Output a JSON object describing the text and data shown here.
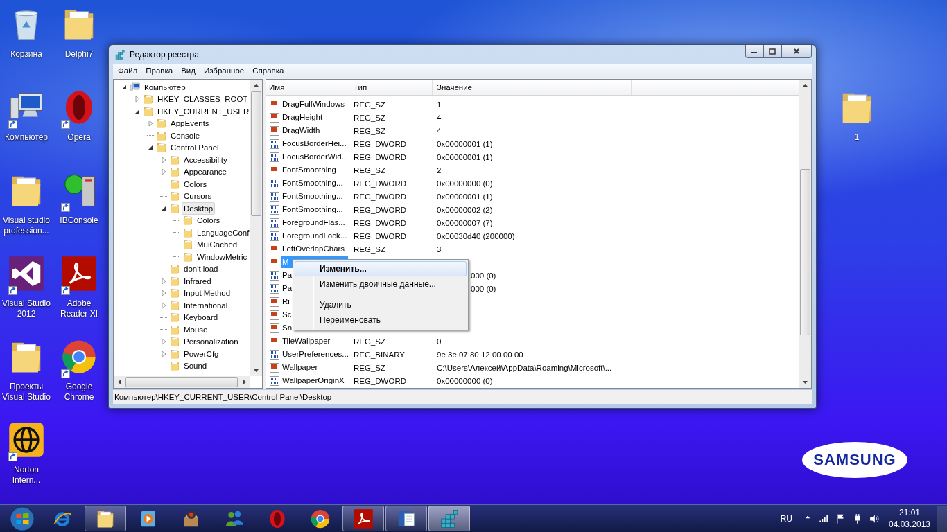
{
  "desktop_icons": [
    {
      "label": "Корзина",
      "kind": "recycle",
      "shortcut": false
    },
    {
      "label": "Delphi7",
      "kind": "folder",
      "shortcut": false
    },
    {
      "label": "Компьютер",
      "kind": "computer",
      "shortcut": true
    },
    {
      "label": "Opera",
      "kind": "opera",
      "shortcut": true
    },
    {
      "label": "Visual studio\nprofession...",
      "kind": "folder",
      "shortcut": false
    },
    {
      "label": "IBConsole",
      "kind": "server",
      "shortcut": true
    },
    {
      "label": "Visual Studio\n2012",
      "kind": "vs",
      "shortcut": true
    },
    {
      "label": "Adobe\nReader XI",
      "kind": "pdf",
      "shortcut": true
    },
    {
      "label": "Проекты\nVisual Studio",
      "kind": "folder",
      "shortcut": false
    },
    {
      "label": "Google\nChrome",
      "kind": "chrome",
      "shortcut": true
    },
    {
      "label": "Norton\nIntern...",
      "kind": "norton",
      "shortcut": true
    }
  ],
  "desktop_icons_right": [
    {
      "label": "1",
      "kind": "folder",
      "shortcut": false
    }
  ],
  "wallpaper_logo": "SAMSUNG",
  "window": {
    "title": "Редактор реестра",
    "menu": [
      "Файл",
      "Правка",
      "Вид",
      "Избранное",
      "Справка"
    ],
    "tree": {
      "label": "Компьютер",
      "kind": "expanded",
      "selected": false,
      "children": [
        {
          "label": "HKEY_CLASSES_ROOT",
          "kind": "collapsed",
          "selected": false
        },
        {
          "label": "HKEY_CURRENT_USER",
          "kind": "expanded",
          "selected": false,
          "children": [
            {
              "label": "AppEvents",
              "kind": "collapsed",
              "selected": false
            },
            {
              "label": "Console",
              "kind": "leaf",
              "selected": false
            },
            {
              "label": "Control Panel",
              "kind": "expanded",
              "selected": false,
              "children": [
                {
                  "label": "Accessibility",
                  "kind": "collapsed",
                  "selected": false
                },
                {
                  "label": "Appearance",
                  "kind": "collapsed",
                  "selected": false
                },
                {
                  "label": "Colors",
                  "kind": "leaf",
                  "selected": false
                },
                {
                  "label": "Cursors",
                  "kind": "leaf",
                  "selected": false
                },
                {
                  "label": "Desktop",
                  "kind": "expanded",
                  "selected": true,
                  "children": [
                    {
                      "label": "Colors",
                      "kind": "leaf",
                      "selected": false
                    },
                    {
                      "label": "LanguageConf",
                      "kind": "leaf",
                      "selected": false
                    },
                    {
                      "label": "MuiCached",
                      "kind": "leaf",
                      "selected": false
                    },
                    {
                      "label": "WindowMetric",
                      "kind": "leaf",
                      "selected": false
                    }
                  ]
                },
                {
                  "label": "don't load",
                  "kind": "leaf",
                  "selected": false
                },
                {
                  "label": "Infrared",
                  "kind": "collapsed",
                  "selected": false
                },
                {
                  "label": "Input Method",
                  "kind": "collapsed",
                  "selected": false
                },
                {
                  "label": "International",
                  "kind": "collapsed",
                  "selected": false
                },
                {
                  "label": "Keyboard",
                  "kind": "leaf",
                  "selected": false
                },
                {
                  "label": "Mouse",
                  "kind": "leaf",
                  "selected": false
                },
                {
                  "label": "Personalization",
                  "kind": "collapsed",
                  "selected": false
                },
                {
                  "label": "PowerCfg",
                  "kind": "collapsed",
                  "selected": false
                },
                {
                  "label": "Sound",
                  "kind": "leaf",
                  "selected": false
                }
              ]
            }
          ]
        }
      ]
    },
    "list": {
      "columns": [
        "Имя",
        "Тип",
        "Значение"
      ],
      "rows": [
        {
          "name": "DragFullWindows",
          "type": "REG_SZ",
          "value": "1",
          "kind": "string",
          "selected": false
        },
        {
          "name": "DragHeight",
          "type": "REG_SZ",
          "value": "4",
          "kind": "string",
          "selected": false
        },
        {
          "name": "DragWidth",
          "type": "REG_SZ",
          "value": "4",
          "kind": "string",
          "selected": false
        },
        {
          "name": "FocusBorderHei...",
          "type": "REG_DWORD",
          "value": "0x00000001 (1)",
          "kind": "binary",
          "selected": false
        },
        {
          "name": "FocusBorderWid...",
          "type": "REG_DWORD",
          "value": "0x00000001 (1)",
          "kind": "binary",
          "selected": false
        },
        {
          "name": "FontSmoothing",
          "type": "REG_SZ",
          "value": "2",
          "kind": "string",
          "selected": false
        },
        {
          "name": "FontSmoothing...",
          "type": "REG_DWORD",
          "value": "0x00000000 (0)",
          "kind": "binary",
          "selected": false
        },
        {
          "name": "FontSmoothing...",
          "type": "REG_DWORD",
          "value": "0x00000001 (1)",
          "kind": "binary",
          "selected": false
        },
        {
          "name": "FontSmoothing...",
          "type": "REG_DWORD",
          "value": "0x00000002 (2)",
          "kind": "binary",
          "selected": false
        },
        {
          "name": "ForegroundFlas...",
          "type": "REG_DWORD",
          "value": "0x00000007 (7)",
          "kind": "binary",
          "selected": false
        },
        {
          "name": "ForegroundLock...",
          "type": "REG_DWORD",
          "value": "0x00030d40 (200000)",
          "kind": "binary",
          "selected": false
        },
        {
          "name": "LeftOverlapChars",
          "type": "REG_SZ",
          "value": "3",
          "kind": "string",
          "selected": false
        },
        {
          "name": "M",
          "kind": "string",
          "selected": true
        },
        {
          "name": "Pa",
          "value": "000 (0)",
          "kind": "binary",
          "selected": false
        },
        {
          "name": "Pa",
          "value": "000 (0)",
          "kind": "binary",
          "selected": false
        },
        {
          "name": "Ri",
          "kind": "string",
          "selected": false
        },
        {
          "name": "Sc",
          "kind": "string",
          "selected": false
        },
        {
          "name": "Sn",
          "kind": "string",
          "selected": false
        },
        {
          "name": "TileWallpaper",
          "type": "REG_SZ",
          "value": "0",
          "kind": "string",
          "selected": false
        },
        {
          "name": "UserPreferences...",
          "type": "REG_BINARY",
          "value": "9e 3e 07 80 12 00 00 00",
          "kind": "binary",
          "selected": false
        },
        {
          "name": "Wallpaper",
          "type": "REG_SZ",
          "value": "C:\\Users\\Алексей\\AppData\\Roaming\\Microsoft\\...",
          "kind": "string",
          "selected": false
        },
        {
          "name": "WallpaperOriginX",
          "type": "REG_DWORD",
          "value": "0x00000000 (0)",
          "kind": "binary",
          "selected": false
        }
      ]
    },
    "context_menu": [
      {
        "kind": "item",
        "label": "Изменить...",
        "default": true,
        "selected": true
      },
      {
        "kind": "item",
        "label": "Изменить двоичные данные...",
        "default": false,
        "selected": false
      },
      {
        "kind": "separator"
      },
      {
        "kind": "item",
        "label": "Удалить",
        "default": false,
        "selected": false
      },
      {
        "kind": "item",
        "label": "Переименовать",
        "default": false,
        "selected": false
      }
    ],
    "status_bar": "Компьютер\\HKEY_CURRENT_USER\\Control Panel\\Desktop"
  },
  "taskbar": {
    "items": [
      {
        "kind": "ie",
        "running": false,
        "active": false
      },
      {
        "kind": "folder",
        "running": true,
        "active": false
      },
      {
        "kind": "media",
        "running": false,
        "active": false
      },
      {
        "kind": "box",
        "running": false,
        "active": false
      },
      {
        "kind": "people",
        "running": false,
        "active": false
      },
      {
        "kind": "opera",
        "running": false,
        "active": false
      },
      {
        "kind": "chrome",
        "running": false,
        "active": false
      },
      {
        "kind": "pdf",
        "running": true,
        "active": false
      },
      {
        "kind": "word",
        "running": true,
        "active": false
      },
      {
        "kind": "regedit",
        "running": true,
        "active": true
      }
    ],
    "tray": {
      "language": "RU",
      "time": "21:01",
      "date": "04.03.2013"
    }
  }
}
